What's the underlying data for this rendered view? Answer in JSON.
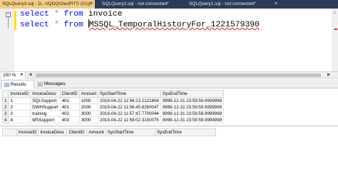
{
  "tabs": [
    {
      "label": "SQLQuery3.sql - D...VQDQ\\GeoPITS (51))*",
      "close": "×"
    },
    {
      "label": "SQLQuery2.sql - not connected*",
      "close": ""
    },
    {
      "label": "SQLQuery1.sql - not connected*",
      "close": "×"
    }
  ],
  "editor": {
    "line1": {
      "kw1": "select",
      "op": "*",
      "kw2": "from",
      "id": "invoice"
    },
    "line2": {
      "kw1": "select",
      "op": "*",
      "kw2": "from",
      "id": "MSSQL_TemporalHistoryFor_1221579390"
    }
  },
  "zoom": "150 %",
  "result_tabs": [
    "Results",
    "Messages"
  ],
  "grid1": {
    "columns": [
      "InvoiceID",
      "InvoiceDesc",
      "ClientID",
      "Amount",
      "SysStartTime",
      "SysEndTime"
    ],
    "rows": [
      {
        "n": "1",
        "cells": [
          "1",
          "SQLSupport",
          "401",
          "1000",
          "2019-04-22 11:56:23.2121804",
          "9999-12-31 23:59:59.9999999"
        ]
      },
      {
        "n": "2",
        "cells": [
          "2",
          "DWHSupport",
          "401",
          "2000",
          "2019-04-22 11:56:45.8260047",
          "9999-12-31 23:59:59.9999999"
        ]
      },
      {
        "n": "3",
        "cells": [
          "3",
          "training",
          "402",
          "3000",
          "2019-04-22 11:57:47.7700044",
          "9999-12-31 23:59:59.9999999"
        ]
      },
      {
        "n": "4",
        "cells": [
          "4",
          "MSSupport",
          "403",
          "3000",
          "2019-04-22 11:58:02.3150075",
          "9999-12-31 23:59:59.9999999"
        ]
      }
    ]
  },
  "grid2": {
    "columns": [
      "InvoiceID",
      "InvoiceDesc",
      "ClientID",
      "Amount",
      "SysStartTime",
      "SysEndTime"
    ]
  }
}
